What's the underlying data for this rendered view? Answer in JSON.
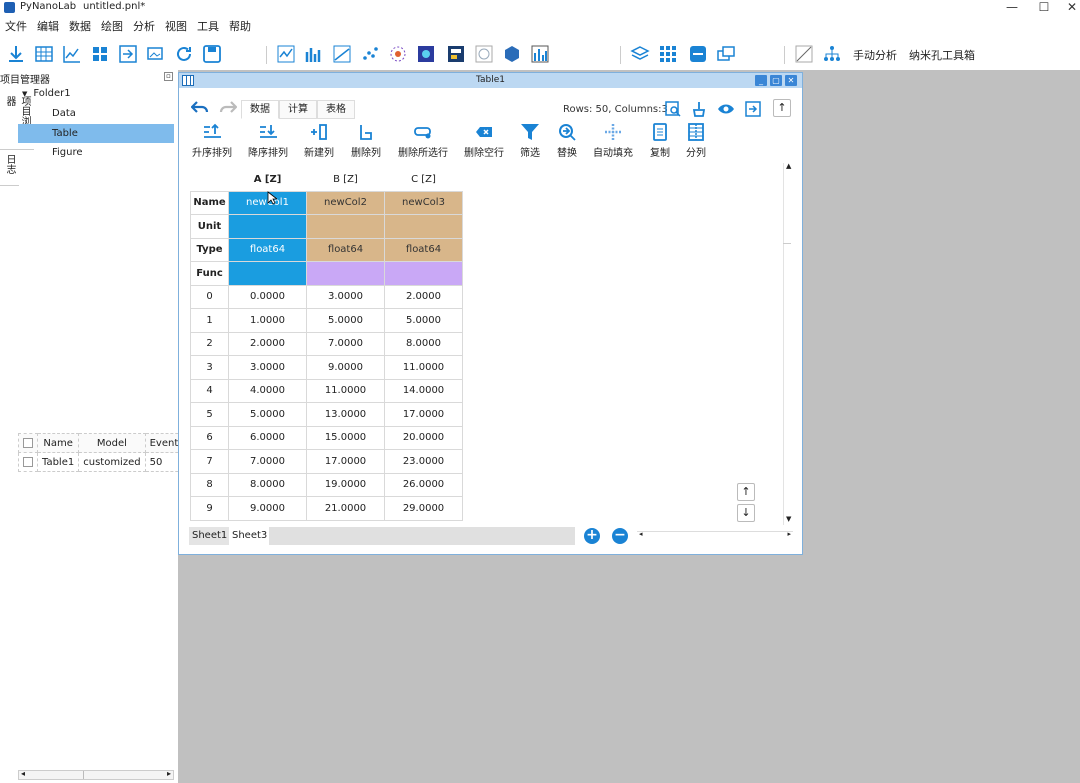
{
  "app": {
    "name": "PyNanoLab",
    "document": "untitled.pnl*"
  },
  "window_controls": {
    "minimize": "—",
    "maximize": "☐",
    "close": "✕"
  },
  "menu": [
    "文件",
    "编辑",
    "数据",
    "绘图",
    "分析",
    "视图",
    "工具",
    "帮助"
  ],
  "toolbar": {
    "manual_analysis": "手动分析",
    "nanopore_toolbox": "纳米孔工具箱"
  },
  "project_manager": {
    "title": "项目管理器",
    "side_tabs": [
      "项目浏览器",
      "日志"
    ],
    "tree": {
      "folder": "Folder1",
      "items": [
        "Data",
        "Table",
        "Figure"
      ],
      "selected": "Table"
    }
  },
  "model_table": {
    "headers": [
      "Name",
      "Model",
      "Events"
    ],
    "rows": [
      {
        "name": "Table1",
        "model": "customized",
        "events": "50"
      }
    ]
  },
  "table_window": {
    "title": "Table1",
    "controls": {
      "minimize": "_",
      "restore": "▢",
      "close": "✕"
    },
    "tabs": [
      "数据",
      "计算",
      "表格"
    ],
    "active_tab": "数据",
    "rows_info": "Rows: 50, Columns:3",
    "ribbon": [
      "升序排列",
      "降序排列",
      "新建列",
      "删除列",
      "删除所选行",
      "删除空行",
      "筛选",
      "替换",
      "自动填充",
      "复制",
      "分列"
    ],
    "columns": [
      "A [Z]",
      "B [Z]",
      "C [Z]"
    ],
    "meta_rows": [
      {
        "label": "Name",
        "values": [
          "newCol1",
          "newCol2",
          "newCol3"
        ]
      },
      {
        "label": "Unit",
        "values": [
          "",
          "",
          ""
        ]
      },
      {
        "label": "Type",
        "values": [
          "float64",
          "float64",
          "float64"
        ]
      },
      {
        "label": "Func",
        "values": [
          "",
          "",
          ""
        ]
      }
    ],
    "data_rows": [
      {
        "index": "0",
        "values": [
          "0.0000",
          "3.0000",
          "2.0000"
        ]
      },
      {
        "index": "1",
        "values": [
          "1.0000",
          "5.0000",
          "5.0000"
        ]
      },
      {
        "index": "2",
        "values": [
          "2.0000",
          "7.0000",
          "8.0000"
        ]
      },
      {
        "index": "3",
        "values": [
          "3.0000",
          "9.0000",
          "11.0000"
        ]
      },
      {
        "index": "4",
        "values": [
          "4.0000",
          "11.0000",
          "14.0000"
        ]
      },
      {
        "index": "5",
        "values": [
          "5.0000",
          "13.0000",
          "17.0000"
        ]
      },
      {
        "index": "6",
        "values": [
          "6.0000",
          "15.0000",
          "20.0000"
        ]
      },
      {
        "index": "7",
        "values": [
          "7.0000",
          "17.0000",
          "23.0000"
        ]
      },
      {
        "index": "8",
        "values": [
          "8.0000",
          "19.0000",
          "26.0000"
        ]
      },
      {
        "index": "9",
        "values": [
          "9.0000",
          "21.0000",
          "29.0000"
        ]
      }
    ],
    "sheets": [
      "Sheet1",
      "Sheet3"
    ],
    "scroll_up": "↑",
    "scroll_down": "↓",
    "add_sheet": "+",
    "remove_sheet": "−"
  },
  "colors": {
    "name_col_a": "#1a9de0",
    "name_col_bc": "#d8b68a",
    "func_col_bc": "#c9a8f6",
    "accent": "#1a83d4"
  }
}
